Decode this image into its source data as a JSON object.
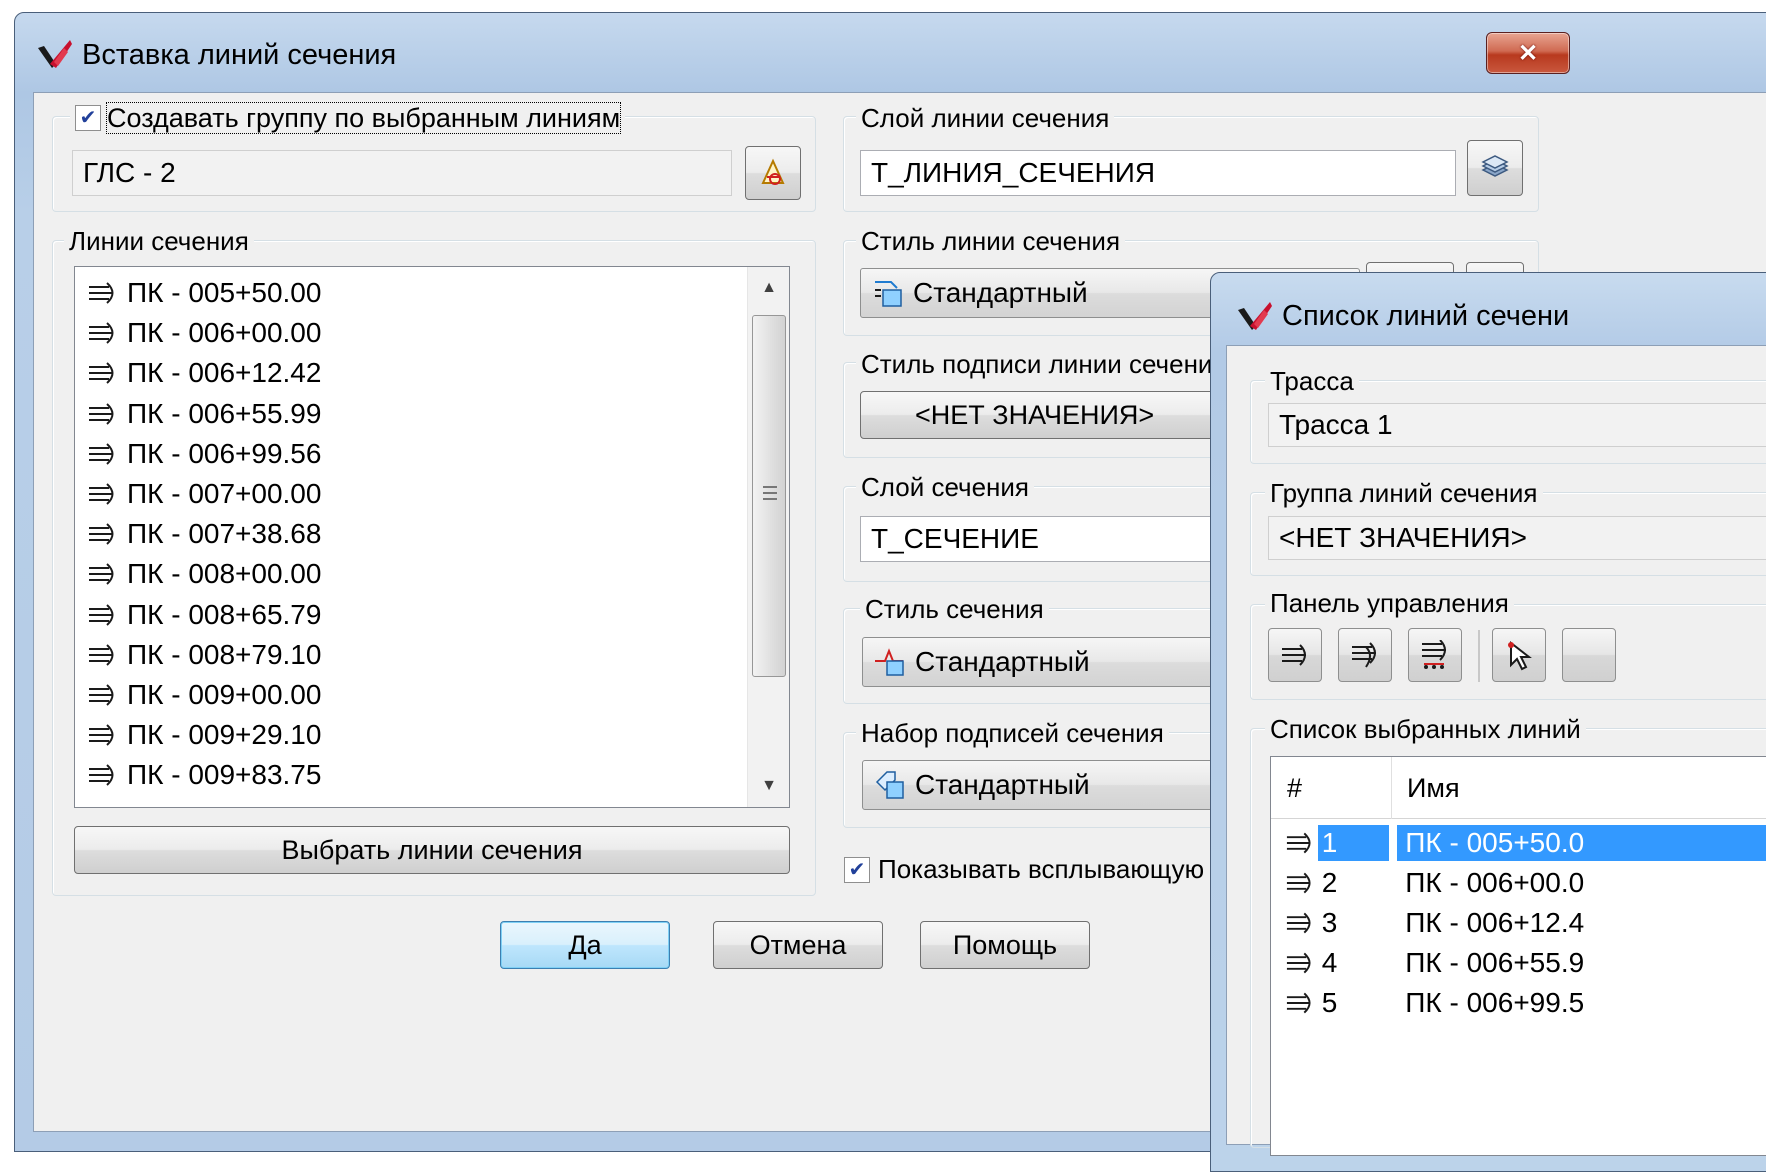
{
  "main_window": {
    "title": "Вставка линий сечения",
    "close_symbol": "✕"
  },
  "group": {
    "checkbox_label": "Создавать группу по выбранным линиям",
    "checked": true,
    "name_value": "ГЛС - 2"
  },
  "section_lines": {
    "label": "Линии сечения",
    "items": [
      "ПК - 005+50.00",
      "ПК - 006+00.00",
      "ПК - 006+12.42",
      "ПК - 006+55.99",
      "ПК - 006+99.56",
      "ПК - 007+00.00",
      "ПК - 007+38.68",
      "ПК - 008+00.00",
      "ПК - 008+65.79",
      "ПК - 008+79.10",
      "ПК - 009+00.00",
      "ПК - 009+29.10",
      "ПК - 009+83.75"
    ],
    "select_button": "Выбрать линии сечения"
  },
  "right_panel": {
    "layer_label": "Слой линии сечения",
    "layer_value": "Т_ЛИНИЯ_СЕЧЕНИЯ",
    "style_label": "Стиль линии сечения",
    "style_value": "Стандартный",
    "label_style_label": "Стиль подписи линии сечения",
    "label_style_value": "<НЕТ ЗНАЧЕНИЯ>",
    "section_layer_label": "Слой сечения",
    "section_layer_value": "Т_СЕЧЕНИЕ",
    "section_style_label": "Стиль сечения",
    "section_style_value": "Стандартный",
    "label_set_label": "Набор подписей сечения",
    "label_set_value": "Стандартный",
    "tooltip_checkbox_label": "Показывать всплывающую",
    "tooltip_checked": true
  },
  "footer": {
    "ok": "Да",
    "cancel": "Отмена",
    "help": "Помощь"
  },
  "list_window": {
    "title": "Список линий сечени",
    "alignment_label": "Трасса",
    "alignment_value": "Трасса 1",
    "group_label": "Группа линий сечения",
    "group_value": "<НЕТ ЗНАЧЕНИЯ>",
    "toolbar_label": "Панель управления",
    "list_label": "Список выбранных линий",
    "columns": [
      "#",
      "Имя"
    ],
    "rows": [
      {
        "num": "1",
        "name": "ПК - 005+50.0",
        "selected": true
      },
      {
        "num": "2",
        "name": "ПК - 006+00.0",
        "selected": false
      },
      {
        "num": "3",
        "name": "ПК - 006+12.4",
        "selected": false
      },
      {
        "num": "4",
        "name": "ПК - 006+55.9",
        "selected": false
      },
      {
        "num": "5",
        "name": "ПК - 006+99.5",
        "selected": false
      }
    ]
  },
  "colors": {
    "selection": "#3399ff",
    "title_bar": "#b8cfe8",
    "client_bg": "#f0f0f0",
    "close_button": "#c9583e"
  },
  "icons": {
    "app": "autocad-civil-logo-icon",
    "section_line": "section-line-icon",
    "layer": "layers-icon",
    "pick": "pick-object-icon",
    "style": "style-icon",
    "section_style": "section-style-icon",
    "label_set": "label-set-icon"
  }
}
